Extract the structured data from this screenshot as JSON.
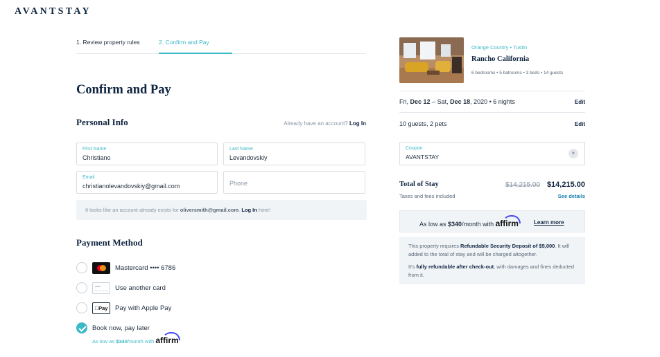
{
  "brand": "AVANTSTAY",
  "steps": [
    "1. Review property rules",
    "2. Confirm and Pay"
  ],
  "page_title": "Confirm and Pay",
  "personal": {
    "title": "Personal Info",
    "account_prefix": "Already have an account?",
    "login_link": "Log In",
    "first_name_label": "First Name",
    "first_name": "Christiano",
    "last_name_label": "Last Name",
    "last_name": "Levandovskiy",
    "email_label": "Email",
    "email": "christianolevandovskiy@gmail.com",
    "phone_placeholder": "Phone",
    "notice_prefix": "It looks like an account already exists for",
    "notice_email": "oliversmith@gmail.com",
    "notice_login": "Log In",
    "notice_suffix": "here!"
  },
  "payment": {
    "title": "Payment Method",
    "options": [
      {
        "label": "Mastercard  •••• 6786",
        "icon": "mastercard-icon",
        "selected": false
      },
      {
        "label": "Use another card",
        "icon": "card-icon",
        "selected": false
      },
      {
        "label": "Pay with Apple Pay",
        "icon": "apple-pay-icon",
        "icon_text": "Pay",
        "selected": false
      },
      {
        "label": "Book now, pay later",
        "selected": true,
        "sub_prefix": "As low as",
        "sub_amount": "$340",
        "sub_suffix": "/month with",
        "sub_brand": "affirm"
      }
    ]
  },
  "property": {
    "location": "Orange Country • Tustin",
    "name": "Rancho California",
    "meta": "6 bedrooms • 5 batrooms • 3 beds • 14 guests"
  },
  "booking": {
    "dates_prefix": "Fri,",
    "date_start": "Dec 12",
    "dates_mid": "– Sat,",
    "date_end": "Dec 18",
    "dates_suffix": ", 2020 • 6 nights",
    "edit_label": "Edit",
    "guests": "10 guests, 2 pets",
    "coupon_label": "Coupon",
    "coupon_value": "AVANTSTAY",
    "clear_glyph": "×",
    "total_label": "Total of Stay",
    "total_old": "$14,215.00",
    "total_new": "$14,215.00",
    "taxes": "Taxes and fees included",
    "see_details": "See details",
    "affirm_prefix": "As low as",
    "affirm_amount": "$340",
    "affirm_suffix": "/month with",
    "affirm_brand": "affirm",
    "learn_more": "Learn more",
    "deposit_1a": "This property requires",
    "deposit_1b": "Refundable Security Deposit of $5,000",
    "deposit_1c": ". It will added to the total of stay and will be charged altogether.",
    "deposit_2a": "It's",
    "deposit_2b": "fully refundable after check-out",
    "deposit_2c": ", with damages and fines deducted from it."
  },
  "colors": {
    "accent": "#3cb9c7",
    "navy": "#0f2440",
    "panel": "#f0f4f7"
  }
}
